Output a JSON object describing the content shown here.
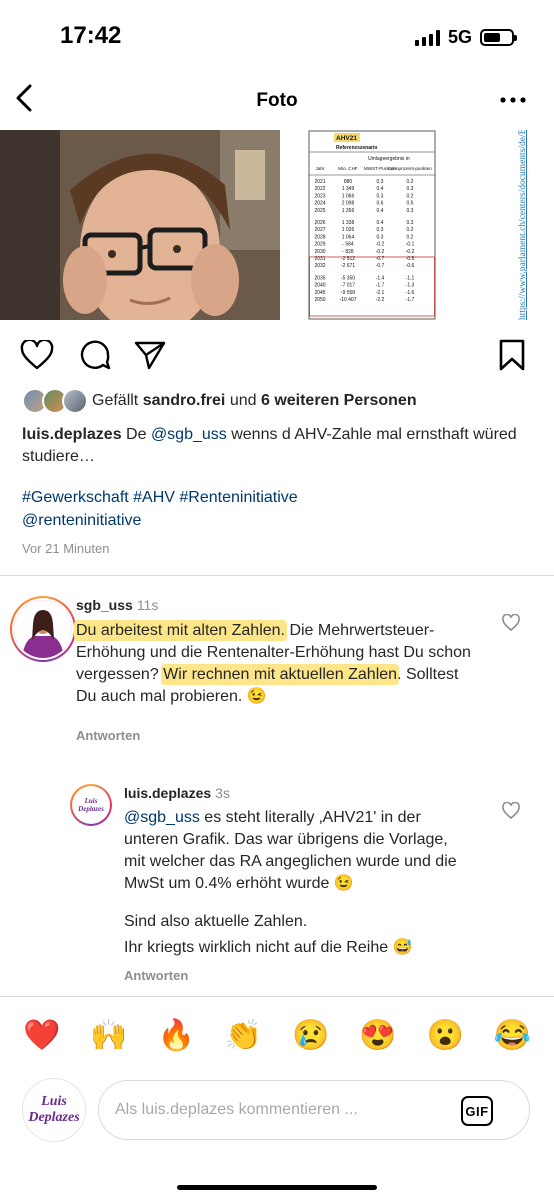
{
  "status_bar": {
    "time": "17:42",
    "network": "5G",
    "battery_level": 0.62
  },
  "nav": {
    "title": "Foto",
    "back_icon": "chevron-left-icon",
    "more_icon": "more-horizontal-icon"
  },
  "post_image": {
    "table": {
      "badge": "AHV21",
      "subtitle": "Referenzszenario",
      "group_header": "Umlageergebnis in",
      "columns": [
        "Jahr",
        "Mio. CHF",
        "MWST-Punkten",
        "Lohnprozent-punkten"
      ],
      "rows": [
        [
          "2021",
          "880",
          "0.3",
          "0.2"
        ],
        [
          "2022",
          "1 349",
          "0.4",
          "0.3"
        ],
        [
          "2023",
          "1 066",
          "0.3",
          "0.2"
        ],
        [
          "2024",
          "2 098",
          "0.6",
          "0.5"
        ],
        [
          "2025",
          "1 356",
          "0.4",
          "0.3"
        ],
        [
          "2026",
          "1 338",
          "0.4",
          "0.3"
        ],
        [
          "2027",
          "1 026",
          "0.3",
          "0.2"
        ],
        [
          "2028",
          "1 064",
          "0.3",
          "0.2"
        ],
        [
          "2029",
          "- 584",
          "-0.2",
          "-0.1"
        ],
        [
          "2030",
          "- 828",
          "-0.2",
          "-0.2"
        ],
        [
          "2031",
          "-2 512",
          "-0.7",
          "-0.5"
        ],
        [
          "2032",
          "-2 671",
          "-0.7",
          "-0.6"
        ],
        [
          "2035",
          "-5 350",
          "-1.4",
          "-1.1"
        ],
        [
          "2040",
          "-7 017",
          "-1.7",
          "-1.3"
        ],
        [
          "2045",
          "-9 558",
          "-2.1",
          "-1.6"
        ],
        [
          "2050",
          "-10 407",
          "-2.2",
          "-1.7"
        ]
      ]
    },
    "source_url": "https://www.parlament.ch/centers/documents/de/Bericht%20Finanzen%20AHV%20D.pdf"
  },
  "likes": {
    "prefix": "Gefällt ",
    "user": "sandro.frei",
    "middle": " und ",
    "others": "6 weiteren Personen"
  },
  "caption": {
    "author": "luis.deplazes",
    "pre": " De ",
    "mention": "@sgb_uss",
    "text": " wenns d AHV-Zahle mal ernsthaft würed studiere…",
    "hashtags": "#Gewerkschaft #AHV #Renteninitiative",
    "tag_mention": "@renteninitiative",
    "time_ago": "Vor 21 Minuten"
  },
  "comments": [
    {
      "user": "sgb_uss",
      "time": "11s",
      "hl1": "Du arbeitest mit alten Zahlen.",
      "part2": " Die Mehrwertsteuer-Erhöhung und die Rentenalter-Erhöhung hast Du schon vergessen? ",
      "hl2": "Wir rechnen mit aktuellen Zahlen",
      "part3": ". Solltest Du auch mal probieren. 😉",
      "reply_label": "Antworten"
    },
    {
      "user": "luis.deplazes",
      "time": "3s",
      "mention": "@sgb_uss",
      "text1": " es steht literally ‚AHV21' in der unteren Grafik. Das war übrigens die Vorlage, mit welcher das RA angeglichen wurde und die MwSt um 0.4% erhöht wurde 😉",
      "text2": "Sind also aktuelle Zahlen.",
      "text3": "Ihr kriegts wirklich nicht auf die Reihe 😅",
      "reply_label": "Antworten",
      "avatar_text_1": "Luis",
      "avatar_text_2": "Deplazes"
    }
  ],
  "emoji_bar": [
    "❤️",
    "🙌",
    "🔥",
    "👏",
    "😢",
    "😍",
    "😮",
    "😂"
  ],
  "composer": {
    "placeholder": "Als luis.deplazes kommentieren ...",
    "gif_label": "GIF",
    "avatar_text_1": "Luis",
    "avatar_text_2": "Deplazes"
  }
}
